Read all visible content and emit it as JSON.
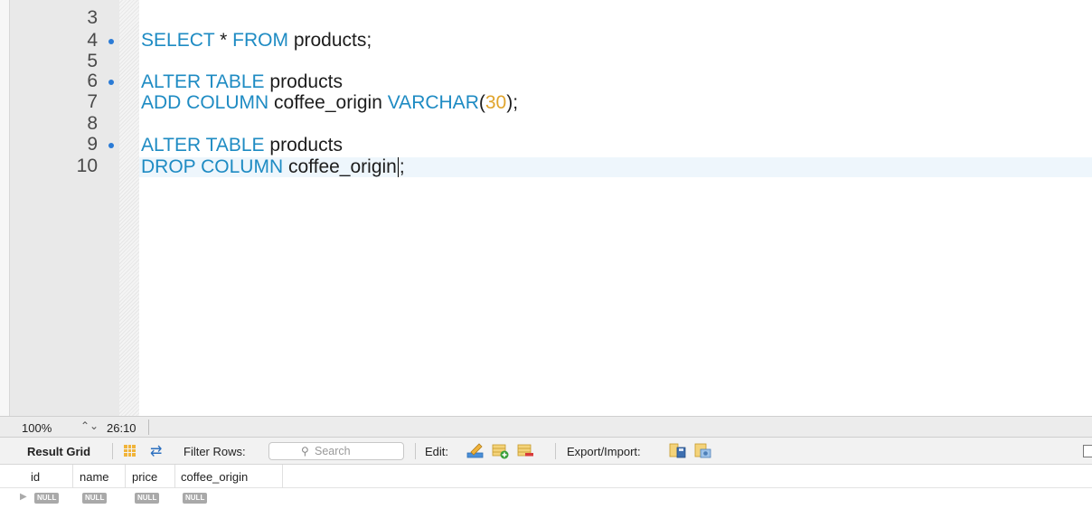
{
  "editor": {
    "line_numbers": [
      "3",
      "4",
      "5",
      "6",
      "7",
      "8",
      "9",
      "10"
    ],
    "lines": {
      "l4": {
        "kw1": "SELECT",
        "t1": " * ",
        "kw2": "FROM",
        "t2": " products;"
      },
      "l6": {
        "kw1": "ALTER TABLE",
        "t1": " products"
      },
      "l7": {
        "kw1": "ADD COLUMN",
        "t1": " coffee_origin ",
        "kw2": "VARCHAR",
        "t2": "(",
        "num": "30",
        "t3": ");"
      },
      "l9": {
        "kw1": "ALTER TABLE",
        "t1": " products"
      },
      "l10": {
        "kw1": "DROP COLUMN",
        "t1": " coffee_origin",
        "t2": ";"
      }
    }
  },
  "status_bar": {
    "zoom": "100%",
    "stepper_glyph": "⌃⌄",
    "cursor_position": "26:10"
  },
  "result_toolbar": {
    "result_grid_label": "Result Grid",
    "filter_rows_label": "Filter Rows:",
    "search_placeholder": "Search",
    "edit_label": "Edit:",
    "export_import_label": "Export/Import:"
  },
  "result_grid": {
    "columns": [
      "id",
      "name",
      "price",
      "coffee_origin"
    ],
    "rows": [
      [
        "NULL",
        "NULL",
        "NULL",
        "NULL"
      ]
    ]
  },
  "colors": {
    "keyword": "#1e8bc3",
    "number": "#e0a42c",
    "breakpoint_marker": "#2a7bd6",
    "null_badge": "#a9a9a9"
  }
}
